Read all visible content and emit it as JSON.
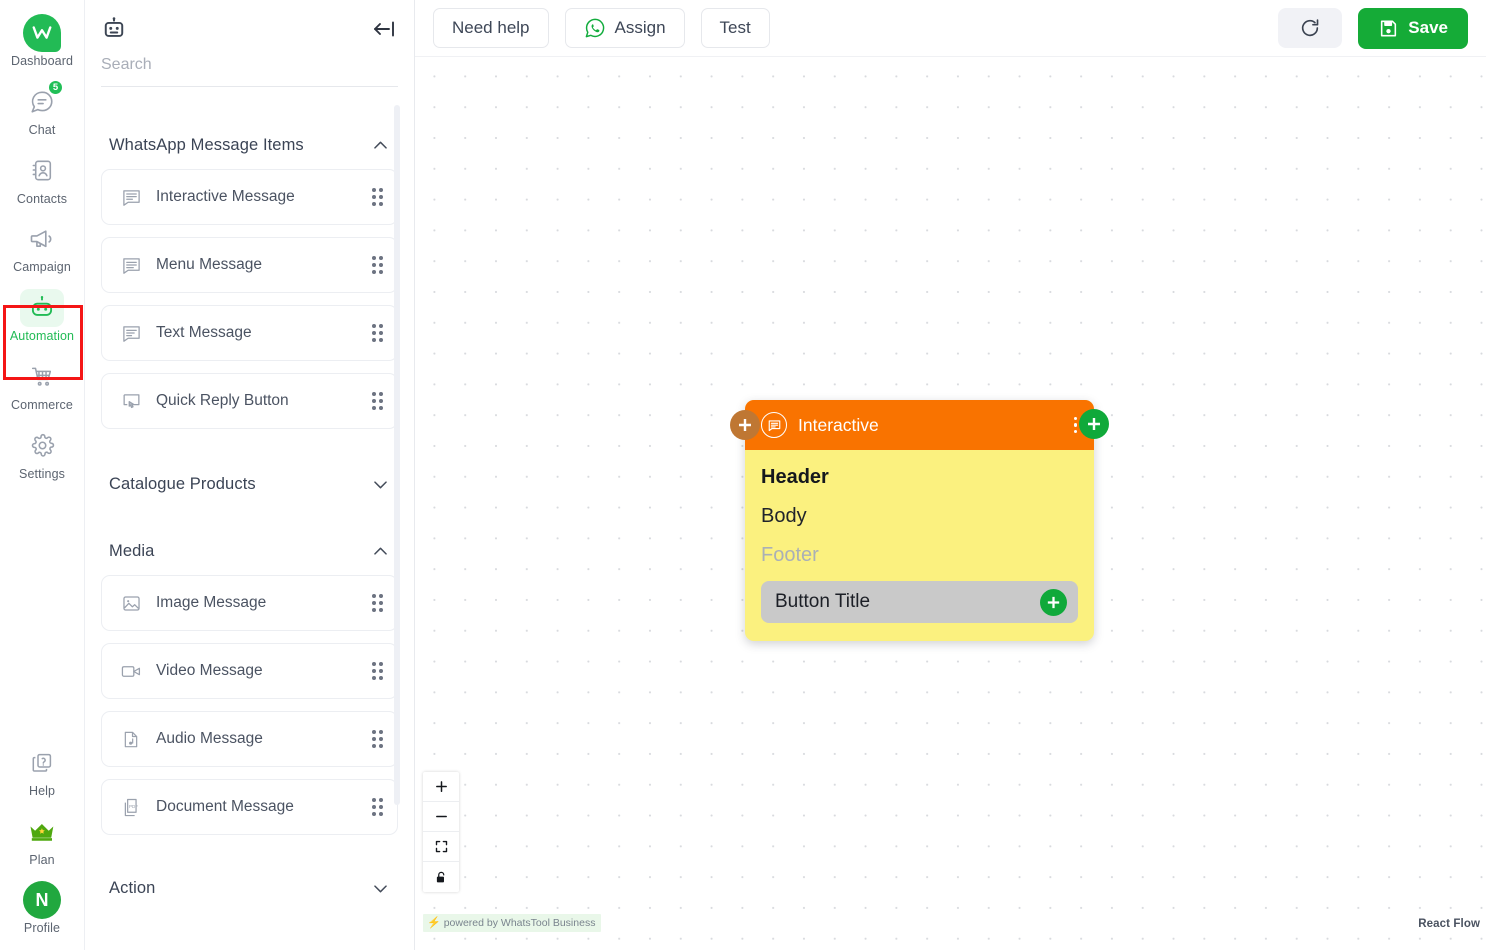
{
  "rail": {
    "items": [
      {
        "label": "Dashboard",
        "icon": "whatstool-logo-icon",
        "badge": null,
        "active": false
      },
      {
        "label": "Chat",
        "icon": "chat-bubble-icon",
        "badge": "5",
        "active": false
      },
      {
        "label": "Contacts",
        "icon": "contacts-book-icon",
        "badge": null,
        "active": false
      },
      {
        "label": "Campaign",
        "icon": "megaphone-icon",
        "badge": null,
        "active": false
      },
      {
        "label": "Automation",
        "icon": "robot-icon",
        "badge": null,
        "active": true
      },
      {
        "label": "Commerce",
        "icon": "shopping-cart-icon",
        "badge": null,
        "active": false
      },
      {
        "label": "Settings",
        "icon": "gear-icon",
        "badge": null,
        "active": false
      }
    ],
    "bottom_items": [
      {
        "label": "Help",
        "icon": "help-question-icon"
      },
      {
        "label": "Plan",
        "icon": "crown-icon"
      },
      {
        "label": "Profile",
        "icon": "avatar-icon",
        "avatar_initial": "N"
      }
    ],
    "active_highlight_color": "#f41616"
  },
  "panel": {
    "bot_icon": "robot-icon",
    "collapse_icon": "collapse-left-icon",
    "search": {
      "value": "",
      "placeholder": "Search"
    },
    "groups": [
      {
        "title": "WhatsApp Message Items",
        "expanded": true,
        "chevron": "chevron-up-icon",
        "items": [
          {
            "label": "Interactive Message",
            "icon": "interactive-message-icon"
          },
          {
            "label": "Menu Message",
            "icon": "menu-message-icon"
          },
          {
            "label": "Text Message",
            "icon": "text-message-icon"
          },
          {
            "label": "Quick Reply Button",
            "icon": "quick-reply-icon"
          }
        ]
      },
      {
        "title": "Catalogue Products",
        "expanded": false,
        "chevron": "chevron-down-icon",
        "items": []
      },
      {
        "title": "Media",
        "expanded": true,
        "chevron": "chevron-up-icon",
        "items": [
          {
            "label": "Image Message",
            "icon": "image-icon"
          },
          {
            "label": "Video Message",
            "icon": "video-camera-icon"
          },
          {
            "label": "Audio Message",
            "icon": "audio-file-icon"
          },
          {
            "label": "Document Message",
            "icon": "pdf-document-icon"
          }
        ]
      },
      {
        "title": "Action",
        "expanded": false,
        "chevron": "chevron-down-icon",
        "items": []
      }
    ]
  },
  "toolbar": {
    "need_help_label": "Need help",
    "assign_label": "Assign",
    "assign_icon": "whatsapp-icon",
    "test_label": "Test",
    "refresh_icon": "refresh-icon",
    "save_label": "Save",
    "save_icon": "floppy-disk-icon",
    "save_color": "#15ab37"
  },
  "node": {
    "type_label": "Interactive",
    "type_icon": "interactive-message-icon",
    "kebab_icon": "kebab-menu-icon",
    "header_text": "Header",
    "body_text": "Body",
    "footer_text": "Footer",
    "button_title": "Button Title",
    "add_button_icon": "plus-circle-icon",
    "left_handle_icon": "plus-circle-icon",
    "right_handle_icon": "plus-circle-icon",
    "header_color": "#f97300",
    "body_color": "#fbf17f",
    "left_handle_color": "#bf7733",
    "right_handle_color": "#10a93a"
  },
  "canvas_controls": {
    "zoom_in_icon": "plus-icon",
    "zoom_out_icon": "minus-icon",
    "fit_view_icon": "fit-view-icon",
    "lock_icon": "lock-icon"
  },
  "attribution": {
    "left_text": "powered by WhatsTool Business",
    "left_icon": "lightning-bolt-icon",
    "right_text": "React Flow"
  }
}
